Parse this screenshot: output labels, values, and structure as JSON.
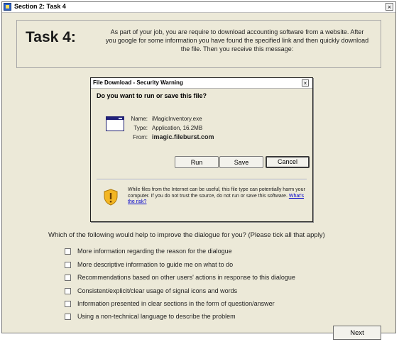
{
  "window": {
    "title": "Section 2: Task 4",
    "close_glyph": "×"
  },
  "task": {
    "heading": "Task 4:",
    "description": "As part of your job, you are require to download accounting software from a website. After you google for some information you have found the specified link and then quickly download the file. Then you receive this message:"
  },
  "dialog": {
    "title": "File Download - Security Warning",
    "close_glyph": "×",
    "question": "Do you want to run or save this file?",
    "name_label": "Name:",
    "name_value": "iMagicInventory.exe",
    "type_label": "Type:",
    "type_value": "Application, 16.2MB",
    "from_label": "From:",
    "from_value": "imagic.fileburst.com",
    "run_label": "Run",
    "save_label": "Save",
    "cancel_label": "Cancel",
    "warning_text": "While files from the Internet can be useful, this file type can potentially harm your computer. If you do not trust the source, do not run or save this software.",
    "risk_link": "What's the risk?"
  },
  "survey": {
    "prompt": "Which of the following would help to improve the dialogue for you? (Please tick all that apply)",
    "options": [
      "More information regarding the reason for the dialogue",
      "More descriptive information to guide me on what to do",
      "Recommendations based on other users' actions in response to this dialogue",
      "Consistent/explicit/clear usage of signal icons and words",
      "Information presented in clear sections in the form of question/answer",
      "Using a non-technical language to describe the problem"
    ],
    "next_label": "Next"
  }
}
